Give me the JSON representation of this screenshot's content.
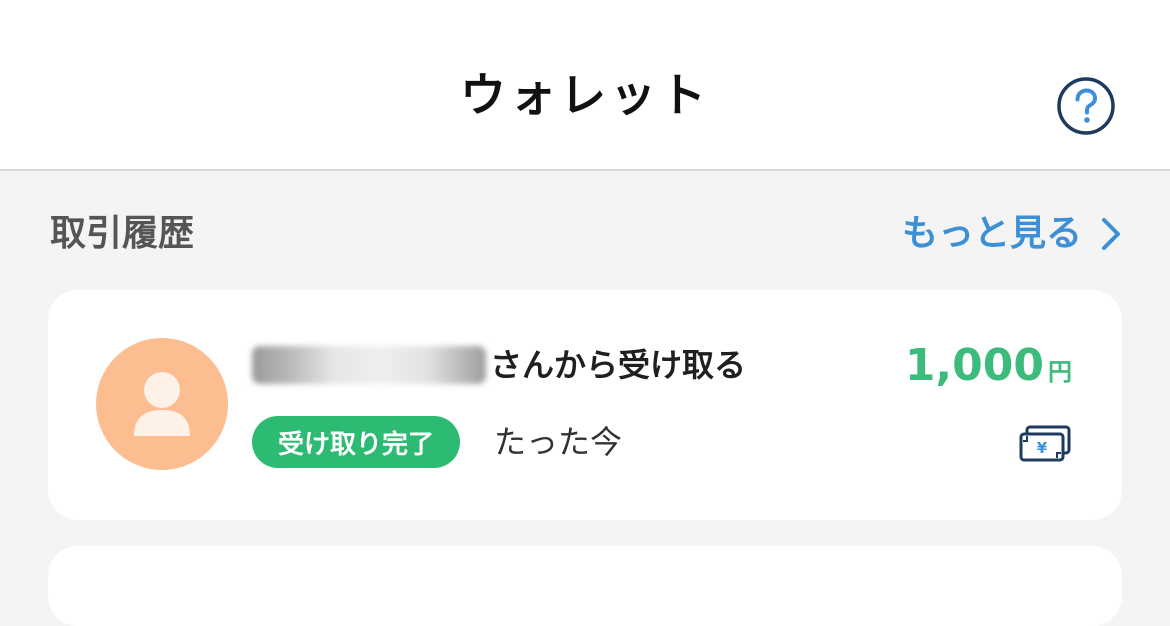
{
  "header": {
    "title": "ウォレット",
    "help_icon": "question-circle-icon"
  },
  "history": {
    "section_title": "取引履歴",
    "more_label": "もっと見る",
    "more_icon": "chevron-right-icon",
    "transactions": [
      {
        "description_suffix": "さんから受け取る",
        "status": "受け取り完了",
        "time": "たった今",
        "amount": "1,000",
        "currency": "円",
        "avatar_icon": "user-avatar-icon",
        "type_icon": "yen-bill-icon"
      }
    ]
  },
  "colors": {
    "accent_blue": "#3d8fd6",
    "success_green": "#2dba72",
    "amount_green": "#3dbb7d",
    "avatar_bg": "#fcbd90"
  }
}
